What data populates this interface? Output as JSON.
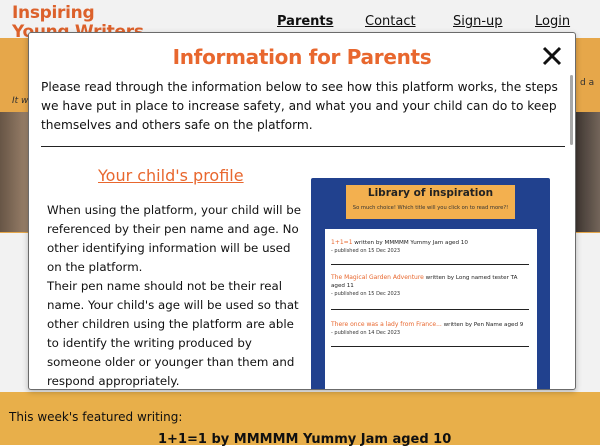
{
  "navbar": {
    "logo": "Inspiring Young Writers",
    "links": [
      "Parents",
      "Contact",
      "Sign-up",
      "Login"
    ]
  },
  "hero": {
    "text_left": "It w",
    "text_right": "d a"
  },
  "featured": {
    "label": "This week's featured writing:",
    "title": "1+1=1 by MMMMM Yummy Jam aged 10"
  },
  "modal": {
    "title": "Information for Parents",
    "close": "X",
    "intro": "Please read through the information below to see how this platform works, the steps we have put in place to increase safety, and what you and your child can do to keep themselves and others safe on the platform.",
    "section_title": "Your child's profile",
    "paragraphs": [
      "When using the platform, your child will be referenced by their pen name and age. No other identifying information will be used on the platform.",
      "Their pen name should not be their real name. Your child's age will be used so that other children using the platform are able to identify the writing produced by someone older or younger than them and respond appropriately."
    ],
    "preview": {
      "title": "Library of inspiration",
      "subtitle": "So much choice! Which title will you click on to read more?!",
      "items": [
        {
          "title": "1+1=1",
          "byline": "written by MMMMM Yummy Jam aged 10",
          "published": "- published on 15 Dec 2023"
        },
        {
          "title": "The Magical Garden Adventure",
          "byline": "written by Long named tester TA aged 11",
          "published": "- published on 15 Dec 2023"
        },
        {
          "title": "There once was a lady from France...",
          "byline": "written by Pen Name aged 9",
          "published": "- published on 14 Dec 2023"
        }
      ]
    }
  },
  "colors": {
    "accent_orange": "#e8672e",
    "banner_yellow": "#f3b04f",
    "library_blue": "#21418e"
  }
}
